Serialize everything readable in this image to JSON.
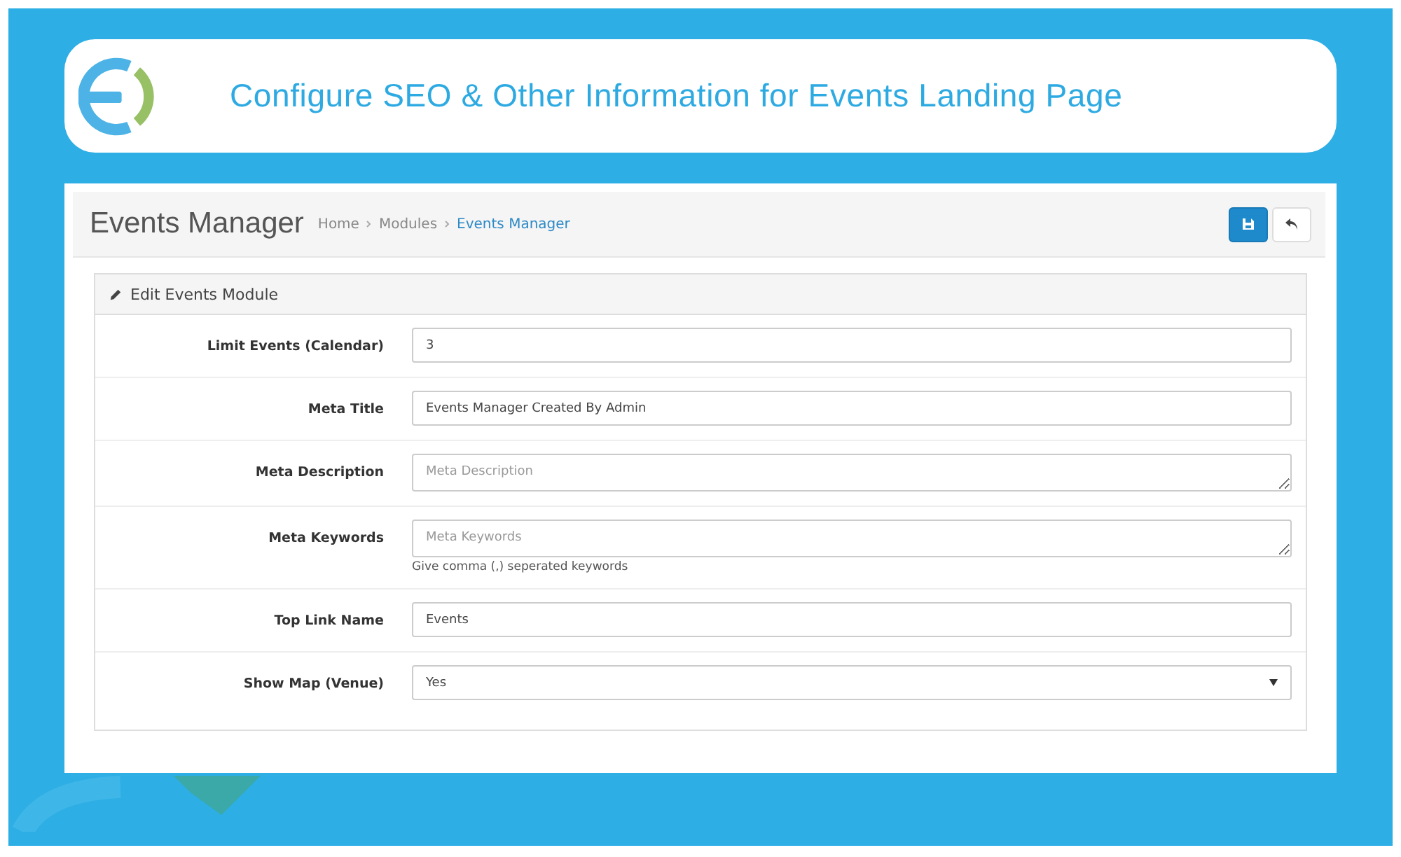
{
  "banner": {
    "title": "Configure SEO & Other Information for Events Landing Page"
  },
  "page_header": {
    "title": "Events Manager",
    "breadcrumb": [
      {
        "label": "Home",
        "active": false
      },
      {
        "label": "Modules",
        "active": false
      },
      {
        "label": "Events Manager",
        "active": true
      }
    ]
  },
  "panel": {
    "title": "Edit Events Module",
    "fields": [
      {
        "kind": "input",
        "label": "Limit Events (Calendar)",
        "value": "3"
      },
      {
        "kind": "input",
        "label": "Meta Title",
        "value": "Events Manager Created By Admin"
      },
      {
        "kind": "textarea",
        "label": "Meta Description",
        "placeholder": "Meta Description"
      },
      {
        "kind": "textarea",
        "label": "Meta Keywords",
        "placeholder": "Meta Keywords",
        "help": "Give comma (,) seperated keywords"
      },
      {
        "kind": "input",
        "label": "Top Link Name",
        "value": "Events"
      },
      {
        "kind": "select",
        "label": "Show Map (Venue)",
        "value": "Yes"
      }
    ]
  }
}
